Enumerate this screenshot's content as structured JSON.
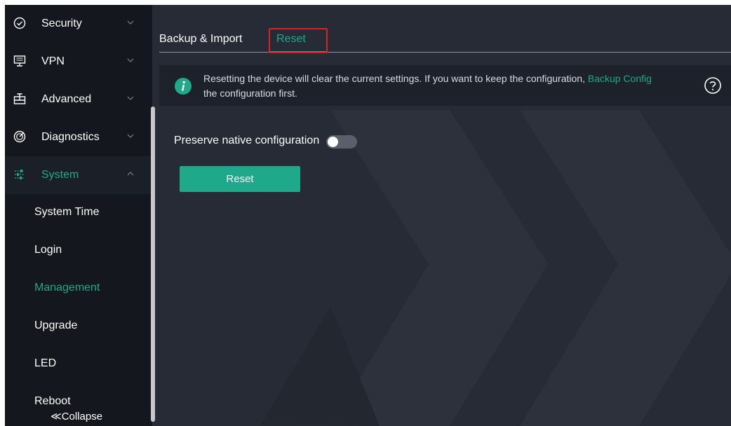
{
  "colors": {
    "accent": "#1fa98a",
    "highlight": "#e02020",
    "sidebar_bg": "#14171d",
    "main_bg": "#262b36"
  },
  "sidebar": {
    "items": [
      {
        "label": "Security",
        "icon": "shield-check-icon"
      },
      {
        "label": "VPN",
        "icon": "vpn-monitor-icon"
      },
      {
        "label": "Advanced",
        "icon": "advanced-panel-icon"
      },
      {
        "label": "Diagnostics",
        "icon": "diagnostics-icon"
      },
      {
        "label": "System",
        "icon": "sliders-icon",
        "active": true
      }
    ],
    "sub_items": [
      "System Time",
      "Login",
      "Management",
      "Upgrade",
      "LED",
      "Reboot"
    ],
    "selected_sub_item": "Management",
    "collapse_label": "≪Collapse"
  },
  "main": {
    "tabs": [
      {
        "label": "Backup & Import"
      },
      {
        "label": "Reset",
        "active": true
      }
    ],
    "notice": {
      "icon": "info-icon",
      "text_before": "Resetting the device will clear the current settings. If you want to keep the configuration,",
      "link": "Backup Config",
      "text_after": "the configuration first.",
      "help_icon": "question-circle-icon"
    },
    "preserve": {
      "label": "Preserve native configuration",
      "enabled": false
    },
    "reset_button": "Reset"
  }
}
